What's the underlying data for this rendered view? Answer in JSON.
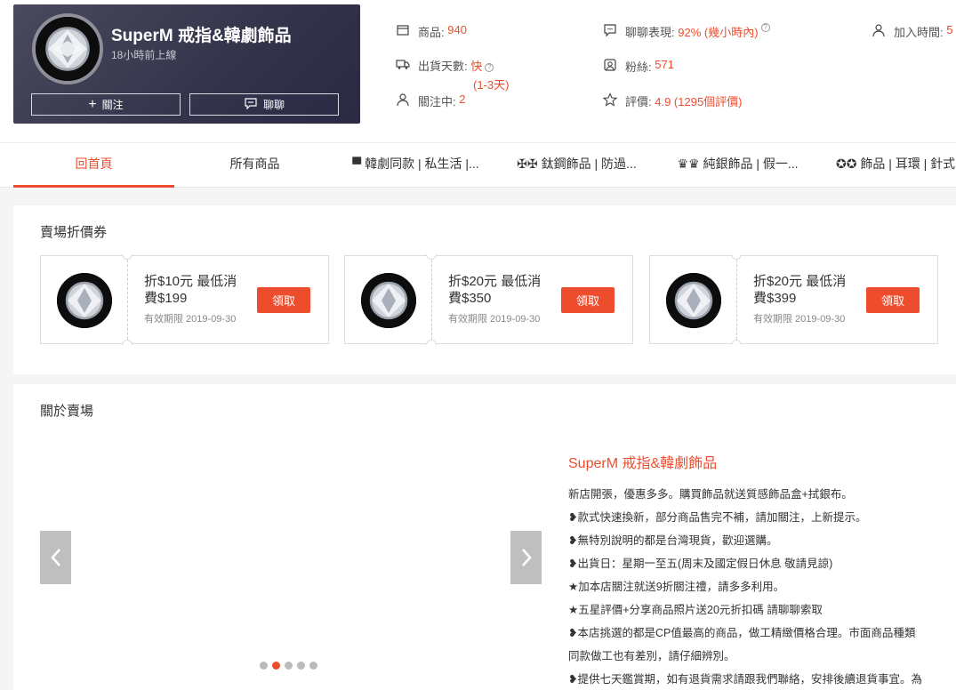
{
  "shop": {
    "name": "SuperM 戒指&韓劇飾品",
    "online_status": "18小時前上線",
    "follow_label": "關注",
    "chat_label": "聊聊"
  },
  "stats": {
    "products_label": "商品:",
    "products_value": "940",
    "shipping_label": "出貨天數:",
    "shipping_value": "快",
    "shipping_sub": "(1-3天)",
    "following_label": "關注中:",
    "following_value": "2",
    "chat_label": "聊聊表現:",
    "chat_value": "92% (幾小時內)",
    "fans_label": "粉絲:",
    "fans_value": "571",
    "rating_label": "評價:",
    "rating_value": "4.9 (1295個評價)",
    "joined_label": "加入時間:",
    "joined_value": "5"
  },
  "tabs": [
    {
      "label": "回首頁"
    },
    {
      "label": "所有商品"
    },
    {
      "label": "▀ 韓劇同款 | 私生活 |..."
    },
    {
      "label": "✠✠ 鈦鋼飾品 | 防過..."
    },
    {
      "label": "♛♛ 純銀飾品 | 假一..."
    },
    {
      "label": "✪✪ 飾品 | 耳環 | 針式"
    }
  ],
  "vouchers": {
    "title": "賣場折價券",
    "items": [
      {
        "line1": "折$10元 最低消",
        "line2": "費$199",
        "expiry": "有效期限 2019-09-30",
        "button": "領取"
      },
      {
        "line1": "折$20元 最低消",
        "line2": "費$350",
        "expiry": "有效期限 2019-09-30",
        "button": "領取"
      },
      {
        "line1": "折$20元 最低消",
        "line2": "費$399",
        "expiry": "有效期限 2019-09-30",
        "button": "領取"
      }
    ]
  },
  "about": {
    "title": "關於賣場",
    "shop_title": "SuperM 戒指&韓劇飾品",
    "lines": [
      "新店開張，優惠多多。購買飾品就送質感飾品盒+拭銀布。",
      "❥款式快速換新，部分商品售完不補，請加關注，上新提示。",
      "❥無特別說明的都是台灣現貨，歡迎選購。",
      "❥出貨日：星期一至五(周末及國定假日休息 敬請見諒)",
      "★加本店關注就送9折關注禮，請多多利用。",
      "★五星評價+分享商品照片送20元折扣碼 請聊聊索取",
      "❥本店挑選的都是CP值最高的商品，做工精緻價格合理。市面商品種類",
      "同款做工也有差別，請仔細辨別。",
      "❥提供七天鑑賞期，如有退貨需求請跟我們聯絡，安排後續退貨事宜。為"
    ],
    "carousel_active": 2,
    "carousel_total": 5
  }
}
